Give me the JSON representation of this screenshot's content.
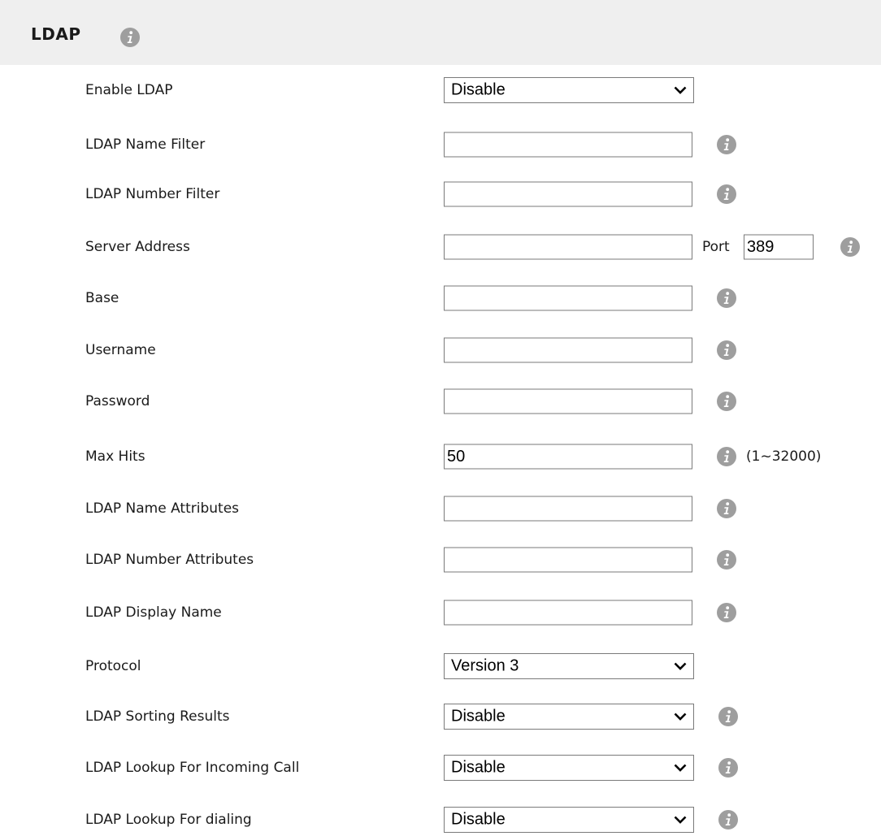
{
  "header": {
    "title": "LDAP"
  },
  "fields": {
    "enable_ldap": {
      "label": "Enable LDAP",
      "value": "Disable"
    },
    "name_filter": {
      "label": "LDAP Name Filter",
      "value": ""
    },
    "number_filter": {
      "label": "LDAP Number Filter",
      "value": ""
    },
    "server_address": {
      "label": "Server Address",
      "value": "",
      "port_label": "Port",
      "port_value": "389"
    },
    "base": {
      "label": "Base",
      "value": ""
    },
    "username": {
      "label": "Username",
      "value": ""
    },
    "password": {
      "label": "Password",
      "value": ""
    },
    "max_hits": {
      "label": "Max Hits",
      "value": "50",
      "range": "(1~32000)"
    },
    "name_attributes": {
      "label": "LDAP Name Attributes",
      "value": ""
    },
    "number_attributes": {
      "label": "LDAP Number Attributes",
      "value": ""
    },
    "display_name": {
      "label": "LDAP Display Name",
      "value": ""
    },
    "protocol": {
      "label": "Protocol",
      "value": "Version 3"
    },
    "sorting_results": {
      "label": "LDAP Sorting Results",
      "value": "Disable"
    },
    "lookup_incoming": {
      "label": "LDAP Lookup For Incoming Call",
      "value": "Disable"
    },
    "lookup_dialing": {
      "label": "LDAP Lookup For dialing",
      "value": "Disable"
    }
  },
  "icons": {
    "info": "info-icon",
    "dropdown": "chevron-down-icon"
  },
  "colors": {
    "header_bg": "#efefef",
    "info_icon": "#9b9b9b",
    "border": "#7a7a7a"
  }
}
